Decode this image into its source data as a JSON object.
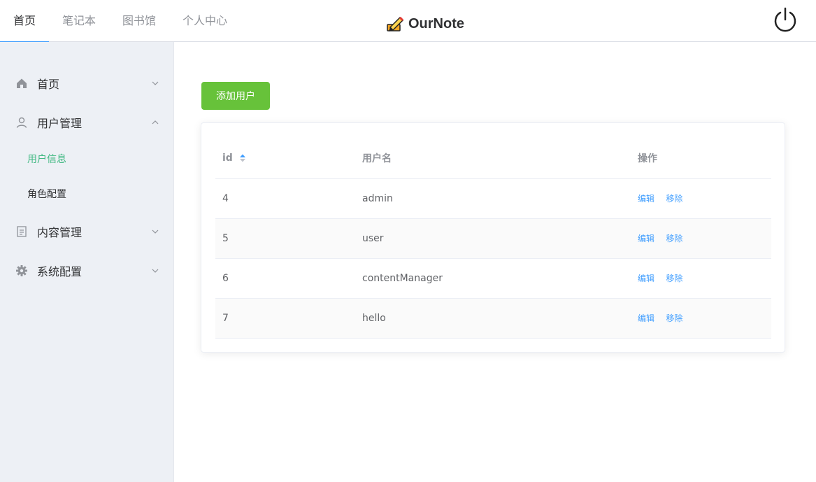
{
  "header": {
    "tabs": [
      {
        "label": "首页",
        "active": true
      },
      {
        "label": "笔记本",
        "active": false
      },
      {
        "label": "图书馆",
        "active": false
      },
      {
        "label": "个人中心",
        "active": false
      }
    ],
    "brand": "OurNote",
    "power_icon": "power-icon"
  },
  "sidebar": {
    "items": [
      {
        "label": "首页",
        "icon": "home-icon",
        "expanded": false
      },
      {
        "label": "用户管理",
        "icon": "user-icon",
        "expanded": true,
        "children": [
          {
            "label": "用户信息",
            "active": true
          },
          {
            "label": "角色配置",
            "active": false
          }
        ]
      },
      {
        "label": "内容管理",
        "icon": "document-icon",
        "expanded": false
      },
      {
        "label": "系统配置",
        "icon": "gear-icon",
        "expanded": false
      }
    ]
  },
  "main": {
    "add_button": "添加用户",
    "table": {
      "columns": [
        "id",
        "用户名",
        "操作"
      ],
      "rows": [
        {
          "id": "4",
          "username": "admin"
        },
        {
          "id": "5",
          "username": "user"
        },
        {
          "id": "6",
          "username": "contentManager"
        },
        {
          "id": "7",
          "username": "hello"
        }
      ],
      "actions": {
        "edit": "编辑",
        "remove": "移除"
      }
    }
  },
  "colors": {
    "primary": "#409eff",
    "success": "#67c23a",
    "active_menu": "#42b983",
    "sidebar_bg": "#edf0f5"
  }
}
